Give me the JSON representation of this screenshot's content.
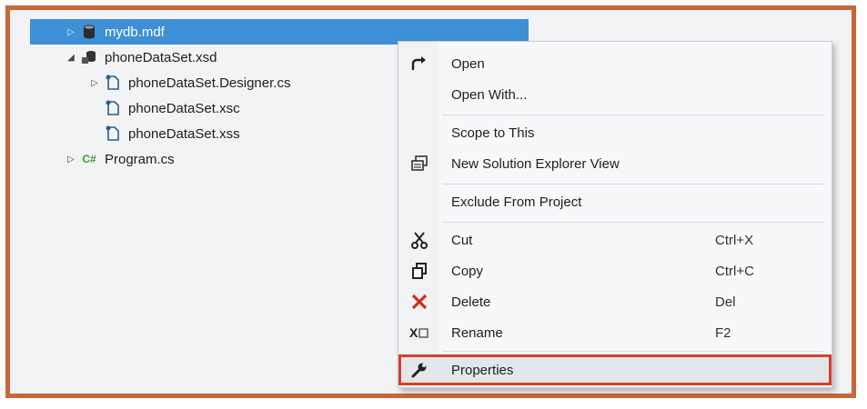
{
  "tree": {
    "items": [
      {
        "label": "mydb.mdf",
        "icon": "database-icon",
        "arrow": "▷",
        "selected": true
      },
      {
        "label": "phoneDataSet.xsd",
        "icon": "dataset-icon",
        "arrow": "◢"
      },
      {
        "label": "phoneDataSet.Designer.cs",
        "icon": "file-icon",
        "arrow": "▷"
      },
      {
        "label": "phoneDataSet.xsc",
        "icon": "file-icon",
        "arrow": ""
      },
      {
        "label": "phoneDataSet.xss",
        "icon": "file-icon",
        "arrow": ""
      },
      {
        "label": "Program.cs",
        "icon": "csharp-icon",
        "arrow": "▷"
      }
    ]
  },
  "menu": {
    "items": [
      {
        "label": "Open",
        "shortcut": "",
        "icon": "open-arrow-icon"
      },
      {
        "label": "Open With...",
        "shortcut": "",
        "icon": ""
      },
      {
        "label": "Scope to This",
        "shortcut": "",
        "icon": ""
      },
      {
        "label": "New Solution Explorer View",
        "shortcut": "",
        "icon": "new-view-icon"
      },
      {
        "label": "Exclude From Project",
        "shortcut": "",
        "icon": ""
      },
      {
        "label": "Cut",
        "shortcut": "Ctrl+X",
        "icon": "scissors-icon"
      },
      {
        "label": "Copy",
        "shortcut": "Ctrl+C",
        "icon": "copy-icon"
      },
      {
        "label": "Delete",
        "shortcut": "Del",
        "icon": "delete-x-icon"
      },
      {
        "label": "Rename",
        "shortcut": "F2",
        "icon": "rename-icon"
      },
      {
        "label": "Properties",
        "shortcut": "",
        "icon": "wrench-icon",
        "highlighted": true
      }
    ]
  },
  "colors": {
    "frame_border": "#c9663a",
    "selection": "#3d8fd6",
    "highlight_outline": "#d6402f",
    "delete_red": "#d42b1e"
  }
}
